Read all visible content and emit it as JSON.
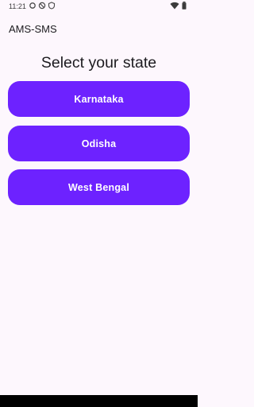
{
  "status_bar": {
    "time": "11:21",
    "left_icons": [
      "notification-dot-icon",
      "do-not-disturb-icon",
      "shield-icon"
    ],
    "right_icons": [
      "wifi-icon",
      "battery-icon"
    ]
  },
  "app_bar": {
    "title": "AMS-SMS"
  },
  "main": {
    "heading": "Select your state",
    "states": [
      {
        "label": "Karnataka"
      },
      {
        "label": "Odisha"
      },
      {
        "label": "West Bengal"
      }
    ]
  },
  "colors": {
    "button": "#6d22ff",
    "background": "#fdf7fd",
    "nav_bar": "#000000"
  }
}
